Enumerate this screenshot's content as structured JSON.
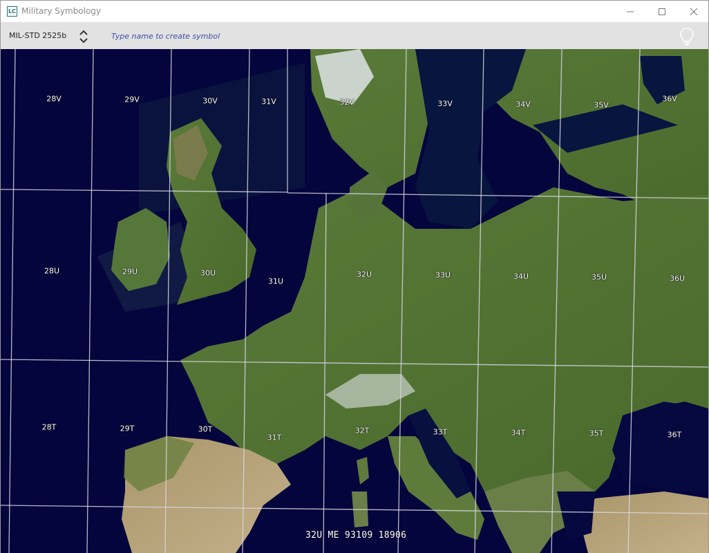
{
  "window": {
    "app_icon_text": "LC",
    "title": "Military Symbology"
  },
  "toolbar": {
    "standard_label": "MIL-STD 2525b",
    "search_placeholder": "Type name to create symbol",
    "search_value": ""
  },
  "map": {
    "layer": "satellite imagery",
    "grid": "UTM/MGRS grid zones",
    "zones": [
      {
        "label": "28V"
      },
      {
        "label": "29V"
      },
      {
        "label": "30V"
      },
      {
        "label": "31V"
      },
      {
        "label": "32V"
      },
      {
        "label": "33V"
      },
      {
        "label": "34V"
      },
      {
        "label": "35V"
      },
      {
        "label": "36V"
      },
      {
        "label": "28U"
      },
      {
        "label": "29U"
      },
      {
        "label": "30U"
      },
      {
        "label": "31U"
      },
      {
        "label": "32U"
      },
      {
        "label": "33U"
      },
      {
        "label": "34U"
      },
      {
        "label": "35U"
      },
      {
        "label": "36U"
      },
      {
        "label": "28T"
      },
      {
        "label": "29T"
      },
      {
        "label": "30T"
      },
      {
        "label": "31T"
      },
      {
        "label": "32T"
      },
      {
        "label": "33T"
      },
      {
        "label": "34T"
      },
      {
        "label": "35T"
      },
      {
        "label": "36T"
      }
    ],
    "coordinate_readout": "32U ME 93109 18906"
  },
  "colors": {
    "ocean": "#05053d",
    "land_green": "#4a6b2e",
    "land_arid": "#b8a27a",
    "snow": "#e8ecef",
    "grid_line": "#d8d8e0",
    "placeholder_text": "#3a4fa8",
    "toolbar_bg": "#e2e2e2"
  }
}
